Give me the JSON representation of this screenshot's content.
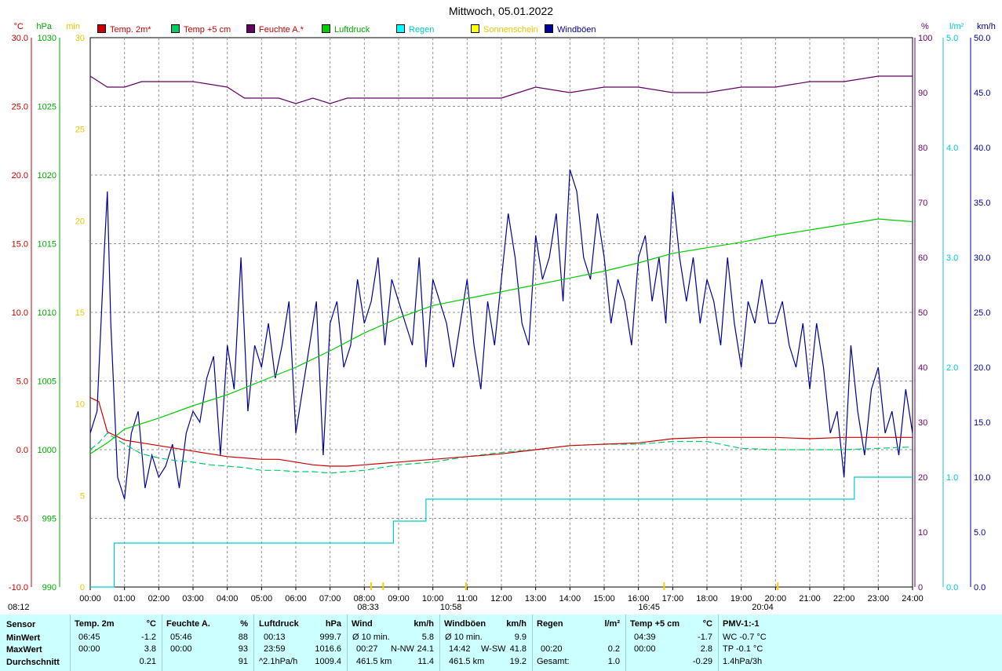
{
  "title": "Mittwoch, 05.01.2022",
  "colors": {
    "temp2m": "#cc0000",
    "temp5cm": "#00cc66",
    "humidity": "#660066",
    "pressure": "#00cc00",
    "rain": "#00cccc",
    "sun": "#ffff00",
    "gusts": "#000099",
    "grid": "#808080",
    "footer_bg": "#ccffff"
  },
  "axes_units": {
    "temp": "°C",
    "pressure": "hPa",
    "sun": "min",
    "humidity": "%",
    "rain": "l/m²",
    "wind": "km/h"
  },
  "legend": [
    {
      "label": "Temp. 2m*",
      "color": "#cc0000",
      "text_color": "#cc0000"
    },
    {
      "label": "Temp +5 cm",
      "color": "#00cc66",
      "text_color": "#cc0000"
    },
    {
      "label": "Feuchte A.*",
      "color": "#660066",
      "text_color": "#cc0000"
    },
    {
      "label": "Luftdruck",
      "color": "#00cc00",
      "text_color": "#00aa00"
    },
    {
      "label": "Regen",
      "color": "#00ffff",
      "text_color": "#00cccc"
    },
    {
      "label": "Sonnenschein",
      "color": "#ffff00",
      "text_color": "#e6c800"
    },
    {
      "label": "Windböen",
      "color": "#000099",
      "text_color": "#000099"
    }
  ],
  "sun_markers": [
    {
      "time": "08:12",
      "label": "08:12"
    },
    {
      "time": "08:33",
      "label": "08:33"
    },
    {
      "time": "10:58",
      "label": "10:58"
    },
    {
      "time": "16:45",
      "label": "16:45"
    },
    {
      "time": "20:04",
      "label": "20:04"
    }
  ],
  "chart_data": {
    "type": "line",
    "title": "Mittwoch, 05.01.2022",
    "x_ticks": [
      "00:00",
      "01:00",
      "02:00",
      "03:00",
      "04:00",
      "05:00",
      "06:00",
      "07:00",
      "08:00",
      "09:00",
      "10:00",
      "11:00",
      "12:00",
      "13:00",
      "14:00",
      "15:00",
      "16:00",
      "17:00",
      "18:00",
      "19:00",
      "20:00",
      "21:00",
      "22:00",
      "23:00",
      "24:00"
    ],
    "xlim": [
      0,
      24
    ],
    "grid": true,
    "legend_position": "top",
    "y_axes": {
      "temp": {
        "ylim": [
          -10,
          30
        ],
        "ticks": [
          "-10.0",
          "-5.0",
          "0.0",
          "5.0",
          "10.0",
          "15.0",
          "20.0",
          "25.0",
          "30.0"
        ]
      },
      "pressure": {
        "ylim": [
          990,
          1030
        ],
        "ticks": [
          "990",
          "995",
          "1000",
          "1005",
          "1010",
          "1015",
          "1020",
          "1025",
          "1030"
        ]
      },
      "sun": {
        "ylim": [
          0,
          30
        ],
        "ticks": [
          "0",
          "5",
          "10",
          "15",
          "20",
          "25",
          "30"
        ]
      },
      "humidity": {
        "ylim": [
          0,
          100
        ],
        "ticks": [
          "0",
          "10",
          "20",
          "30",
          "40",
          "50",
          "60",
          "70",
          "80",
          "90",
          "100"
        ]
      },
      "rain": {
        "ylim": [
          0,
          5
        ],
        "ticks": [
          "0.0",
          "1.0",
          "2.0",
          "3.0",
          "4.0",
          "5.0"
        ]
      },
      "wind": {
        "ylim": [
          0,
          50
        ],
        "ticks": [
          "0.0",
          "5.0",
          "10.0",
          "15.0",
          "20.0",
          "25.0",
          "30.0",
          "35.0",
          "40.0",
          "45.0",
          "50.0"
        ]
      }
    },
    "series": [
      {
        "name": "Temp. 2m*",
        "axis": "temp",
        "x": [
          0,
          0.25,
          0.5,
          1,
          1.5,
          2,
          2.5,
          3,
          3.5,
          4,
          4.5,
          5,
          5.5,
          6,
          6.5,
          7,
          7.5,
          8,
          8.5,
          9,
          10,
          11,
          12,
          13,
          14,
          15,
          16,
          17,
          18,
          19,
          20,
          21,
          22,
          23,
          24
        ],
        "y": [
          3.8,
          3.5,
          1.3,
          0.7,
          0.5,
          0.3,
          0.1,
          -0.1,
          -0.3,
          -0.5,
          -0.6,
          -0.7,
          -0.7,
          -0.9,
          -1.1,
          -1.2,
          -1.2,
          -1.1,
          -1.0,
          -0.9,
          -0.7,
          -0.5,
          -0.3,
          0.0,
          0.3,
          0.4,
          0.5,
          0.8,
          0.9,
          0.9,
          0.9,
          0.8,
          0.9,
          0.9,
          0.9
        ]
      },
      {
        "name": "Temp +5 cm",
        "axis": "temp",
        "x": [
          0,
          0.25,
          0.5,
          1,
          1.5,
          2,
          2.5,
          3,
          3.5,
          4,
          4.5,
          5,
          5.5,
          6,
          6.5,
          7,
          7.5,
          8,
          8.5,
          9,
          10,
          11,
          12,
          13,
          14,
          15,
          16,
          17,
          18,
          19,
          20,
          21,
          22,
          23,
          24
        ],
        "y": [
          0.0,
          0.5,
          1.2,
          0.4,
          -0.3,
          -0.6,
          -0.8,
          -0.9,
          -1.1,
          -1.2,
          -1.3,
          -1.5,
          -1.5,
          -1.6,
          -1.6,
          -1.7,
          -1.6,
          -1.5,
          -1.3,
          -1.1,
          -0.9,
          -0.5,
          -0.2,
          0.0,
          0.3,
          0.4,
          0.4,
          0.6,
          0.6,
          0.1,
          0.0,
          0.0,
          0.0,
          0.1,
          0.2
        ]
      },
      {
        "name": "Feuchte A.*",
        "axis": "humidity",
        "x": [
          0,
          0.5,
          1,
          1.5,
          2,
          3,
          4,
          4.5,
          5,
          5.5,
          6,
          6.5,
          7,
          7.5,
          8,
          9,
          10,
          11,
          12,
          12.5,
          13,
          14,
          15,
          16,
          17,
          18,
          19,
          20,
          21,
          22,
          23,
          24
        ],
        "y": [
          93,
          91,
          91,
          92,
          92,
          92,
          91,
          89,
          89,
          89,
          88,
          89,
          88,
          89,
          89,
          89,
          89,
          89,
          89,
          90,
          91,
          90,
          91,
          91,
          90,
          90,
          91,
          91,
          92,
          92,
          93,
          93
        ]
      },
      {
        "name": "Luftdruck",
        "axis": "pressure",
        "x": [
          0,
          0.5,
          1,
          2,
          3,
          4,
          5,
          6,
          7,
          8,
          9,
          10,
          11,
          12,
          13,
          14,
          15,
          16,
          17,
          18,
          19,
          20,
          21,
          22,
          23,
          24
        ],
        "y": [
          999.7,
          1000.5,
          1001.5,
          1002.3,
          1003.2,
          1004.0,
          1005.0,
          1006.0,
          1007.2,
          1008.5,
          1009.6,
          1010.5,
          1011.0,
          1011.5,
          1012.0,
          1012.5,
          1013.0,
          1013.6,
          1014.3,
          1014.7,
          1015.1,
          1015.6,
          1016.0,
          1016.4,
          1016.8,
          1016.6
        ]
      },
      {
        "name": "Regen",
        "axis": "rain",
        "x": [
          0,
          0.7,
          0.7,
          8.85,
          8.85,
          9.8,
          9.8,
          22.3,
          22.3,
          24
        ],
        "y": [
          0.0,
          0.0,
          0.4,
          0.4,
          0.6,
          0.6,
          0.8,
          0.8,
          1.0,
          1.0
        ]
      },
      {
        "name": "Windböen",
        "axis": "wind",
        "x": [
          0,
          0.2,
          0.4,
          0.5,
          0.6,
          0.8,
          1,
          1.2,
          1.4,
          1.6,
          1.8,
          2,
          2.2,
          2.4,
          2.6,
          2.8,
          3,
          3.2,
          3.4,
          3.6,
          3.8,
          4,
          4.2,
          4.4,
          4.6,
          4.8,
          5,
          5.2,
          5.4,
          5.6,
          5.8,
          6,
          6.2,
          6.4,
          6.6,
          6.8,
          7,
          7.2,
          7.4,
          7.6,
          7.8,
          8,
          8.2,
          8.4,
          8.6,
          8.8,
          9,
          9.2,
          9.4,
          9.6,
          9.8,
          10,
          10.2,
          10.4,
          10.6,
          10.8,
          11,
          11.2,
          11.4,
          11.6,
          11.8,
          12,
          12.2,
          12.4,
          12.6,
          12.8,
          13,
          13.2,
          13.4,
          13.6,
          13.8,
          14,
          14.2,
          14.4,
          14.6,
          14.8,
          15,
          15.2,
          15.4,
          15.6,
          15.8,
          16,
          16.2,
          16.4,
          16.6,
          16.8,
          17,
          17.2,
          17.4,
          17.6,
          17.8,
          18,
          18.2,
          18.4,
          18.6,
          18.8,
          19,
          19.2,
          19.4,
          19.6,
          19.8,
          20,
          20.2,
          20.4,
          20.6,
          20.8,
          21,
          21.2,
          21.4,
          21.6,
          21.8,
          22,
          22.2,
          22.4,
          22.6,
          22.8,
          23,
          23.2,
          23.4,
          23.6,
          23.8,
          24
        ],
        "y": [
          14,
          16,
          30,
          36,
          24,
          10,
          8,
          14,
          16,
          9,
          12,
          10,
          11,
          13,
          9,
          14,
          16,
          15,
          19,
          21,
          12,
          22,
          18,
          30,
          16,
          22,
          20,
          24,
          19,
          22,
          26,
          14,
          18,
          22,
          26,
          12,
          24,
          26,
          20,
          22,
          28,
          24,
          26,
          30,
          22,
          28,
          26,
          24,
          22,
          30,
          20,
          28,
          26,
          24,
          20,
          24,
          28,
          22,
          18,
          26,
          22,
          28,
          34,
          30,
          24,
          22,
          32,
          28,
          30,
          34,
          26,
          38,
          36,
          30,
          28,
          34,
          30,
          24,
          28,
          26,
          22,
          30,
          32,
          26,
          30,
          24,
          36,
          30,
          26,
          30,
          24,
          28,
          26,
          22,
          30,
          24,
          20,
          26,
          24,
          28,
          24,
          24,
          26,
          22,
          20,
          24,
          18,
          24,
          20,
          14,
          16,
          10,
          22,
          16,
          12,
          18,
          20,
          14,
          16,
          12,
          18,
          14
        ]
      }
    ]
  },
  "footer": {
    "row_labels": [
      "Sensor",
      "MinWert",
      "MaxWert",
      "Durchschnitt"
    ],
    "temp2m": {
      "header": "Temp. 2m",
      "unit": "°C",
      "min_time": "06:45",
      "min": "-1.2",
      "max_time": "00:00",
      "max": "3.8",
      "avg": "0.21"
    },
    "humidity": {
      "header": "Feuchte A.",
      "unit": "%",
      "min_time": "05:46",
      "min": "88",
      "max_time": "00:00",
      "max": "93",
      "avg": "91"
    },
    "pressure": {
      "header": "Luftdruck",
      "unit": "hPa",
      "min_time": "00:13",
      "min": "999.7",
      "max_time": "23:59",
      "max": "1016.6",
      "avg_label": "^2.1hPa/h",
      "avg": "1009.4"
    },
    "wind": {
      "header": "Wind",
      "unit": "km/h",
      "min_label": "Ø 10 min.",
      "min": "5.8",
      "max_time": "00:27",
      "max_dir": "N-NW",
      "max": "24.1",
      "avg_label": "461.5 km",
      "avg": "11.4"
    },
    "gusts": {
      "header": "Windböen",
      "unit": "km/h",
      "min_label": "Ø 10 min.",
      "min": "9.9",
      "max_time": "14:42",
      "max_dir": "W-SW",
      "max": "41.8",
      "avg_label": "461.5 km",
      "avg": "19.2"
    },
    "rain": {
      "header": "Regen",
      "unit": "l/m²",
      "max_time": "00:20",
      "max": "0.2",
      "total_label": "Gesamt:",
      "total": "1.0"
    },
    "temp5cm": {
      "header": "Temp +5 cm",
      "unit": "°C",
      "min_time": "04:39",
      "min": "-1.7",
      "max_time": "00:00",
      "max": "2.8",
      "avg": "-0.29"
    },
    "pmv": {
      "header": "PMV-1:-1",
      "wc": "WC -0.7 °C",
      "tp": "TP -0.1 °C",
      "trend": "1.4hPa/3h"
    }
  }
}
